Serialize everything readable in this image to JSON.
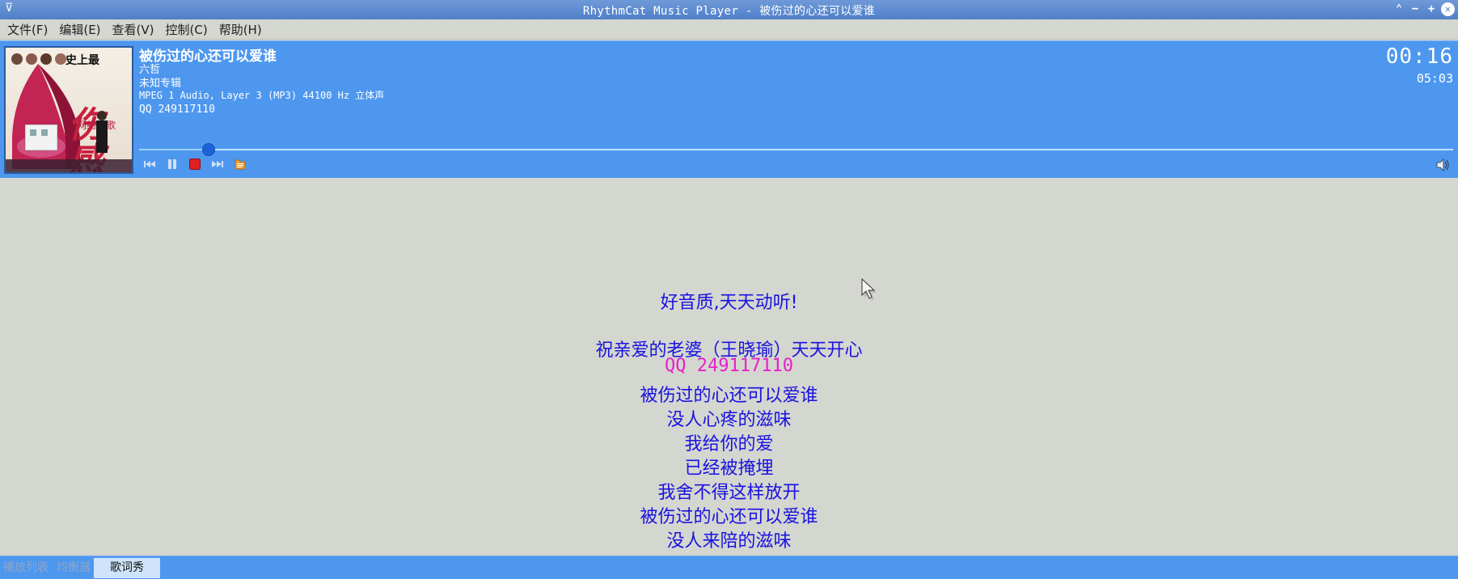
{
  "window": {
    "title": "RhythmCat Music Player - 被伤过的心还可以爱谁"
  },
  "menubar": {
    "items": [
      "文件(F)",
      "编辑(E)",
      "查看(V)",
      "控制(C)",
      "帮助(H)"
    ]
  },
  "now_playing": {
    "title": "被伤过的心还可以爱谁",
    "artist": "六哲",
    "album": "未知专辑",
    "format": "MPEG 1 Audio, Layer 3 (MP3) 44100 Hz 立体声",
    "comment": "QQ  249117110",
    "elapsed": "00:16",
    "total": "05:03",
    "progress": 0.053,
    "cover_text": {
      "top": "史上最",
      "big": "伤感",
      "sub": "网络情歌"
    }
  },
  "controls": {
    "icons": [
      "previous-icon",
      "pause-icon",
      "stop-icon",
      "next-icon",
      "open-file-icon"
    ],
    "colors": {
      "stop": "#e02020",
      "open": "#f0a030"
    }
  },
  "lyrics": {
    "lines": [
      {
        "text": "好音质,天天动听!",
        "style": "normal"
      },
      {
        "text": "祝亲爱的老婆（王晓瑜）天天开心",
        "style": "normal"
      },
      {
        "text": "QQ  249117110",
        "style": "qq"
      },
      {
        "text": "被伤过的心还可以爱谁",
        "style": "normal"
      },
      {
        "text": "没人心疼的滋味",
        "style": "normal"
      },
      {
        "text": "我给你的爱",
        "style": "normal"
      },
      {
        "text": "已经被掩埋",
        "style": "normal"
      },
      {
        "text": "我舍不得这样放开",
        "style": "normal"
      },
      {
        "text": "被伤过的心还可以爱谁",
        "style": "normal"
      },
      {
        "text": "没人来陪的滋味",
        "style": "normal"
      }
    ],
    "colors": {
      "normal": "#1a12e0",
      "highlight": "#e620c8"
    }
  },
  "tabs": {
    "playlist": "播放列表",
    "equalizer": "均衡器",
    "lyrics_show": "歌词秀"
  },
  "colors": {
    "accent": "#4d97ef",
    "background": "#d4d6d0"
  }
}
